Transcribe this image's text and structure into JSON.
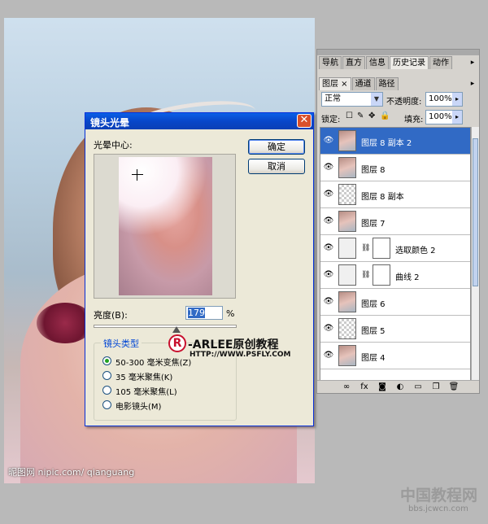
{
  "watermark": "昵图网 nipic.com/ qianguang",
  "dialog": {
    "title": "镜头光晕",
    "close_glyph": "✕",
    "center_label": "光晕中心:",
    "ok_label": "确定",
    "cancel_label": "取消",
    "brightness_label": "亮度(B):",
    "brightness_value": "179",
    "brightness_unit": "%",
    "lens_type_label": "镜头类型",
    "lens_options": [
      {
        "label": "50-300 毫米变焦(Z)",
        "checked": true
      },
      {
        "label": "35 毫米聚焦(K)",
        "checked": false
      },
      {
        "label": "105 毫米聚焦(L)",
        "checked": false
      },
      {
        "label": "电影镜头(M)",
        "checked": false
      }
    ]
  },
  "logo": {
    "mark": "R",
    "name": "-ARLEE原创教程",
    "url": "HTTP://WWW.PSFLY.COM"
  },
  "panel": {
    "top_tabs": [
      "导航",
      "直方",
      "信息",
      "历史记录",
      "动作"
    ],
    "top_tabs_active": 3,
    "sub_tabs": [
      "图层 ×",
      "通道",
      "路径"
    ],
    "blend_mode": "正常",
    "opacity_label": "不透明度:",
    "opacity_value": "100%",
    "lock_label": "锁定:",
    "fill_label": "填充:",
    "fill_value": "100%",
    "layers": [
      {
        "name": "图层 8 副本 2",
        "thumb": "photo",
        "selected": true
      },
      {
        "name": "图层 8",
        "thumb": "photo",
        "selected": false
      },
      {
        "name": "图层 8 副本",
        "thumb": "checker",
        "selected": false
      },
      {
        "name": "图层 7",
        "thumb": "photo",
        "selected": false
      },
      {
        "name": "选取颜色 2",
        "thumb": "adj",
        "mask": true,
        "selected": false
      },
      {
        "name": "曲线 2",
        "thumb": "adj",
        "mask": true,
        "selected": false
      },
      {
        "name": "图层 6",
        "thumb": "photo",
        "selected": false
      },
      {
        "name": "图层 5",
        "thumb": "checker",
        "selected": false
      },
      {
        "name": "图层 4",
        "thumb": "photo",
        "selected": false
      }
    ],
    "footer_icons": [
      "link-icon",
      "fx-icon",
      "mask-icon",
      "adjustment-icon",
      "folder-icon",
      "new-layer-icon",
      "trash-icon"
    ]
  },
  "site_mark": {
    "cn": "中国教程网",
    "url": "bbs.jcwcn.com"
  }
}
